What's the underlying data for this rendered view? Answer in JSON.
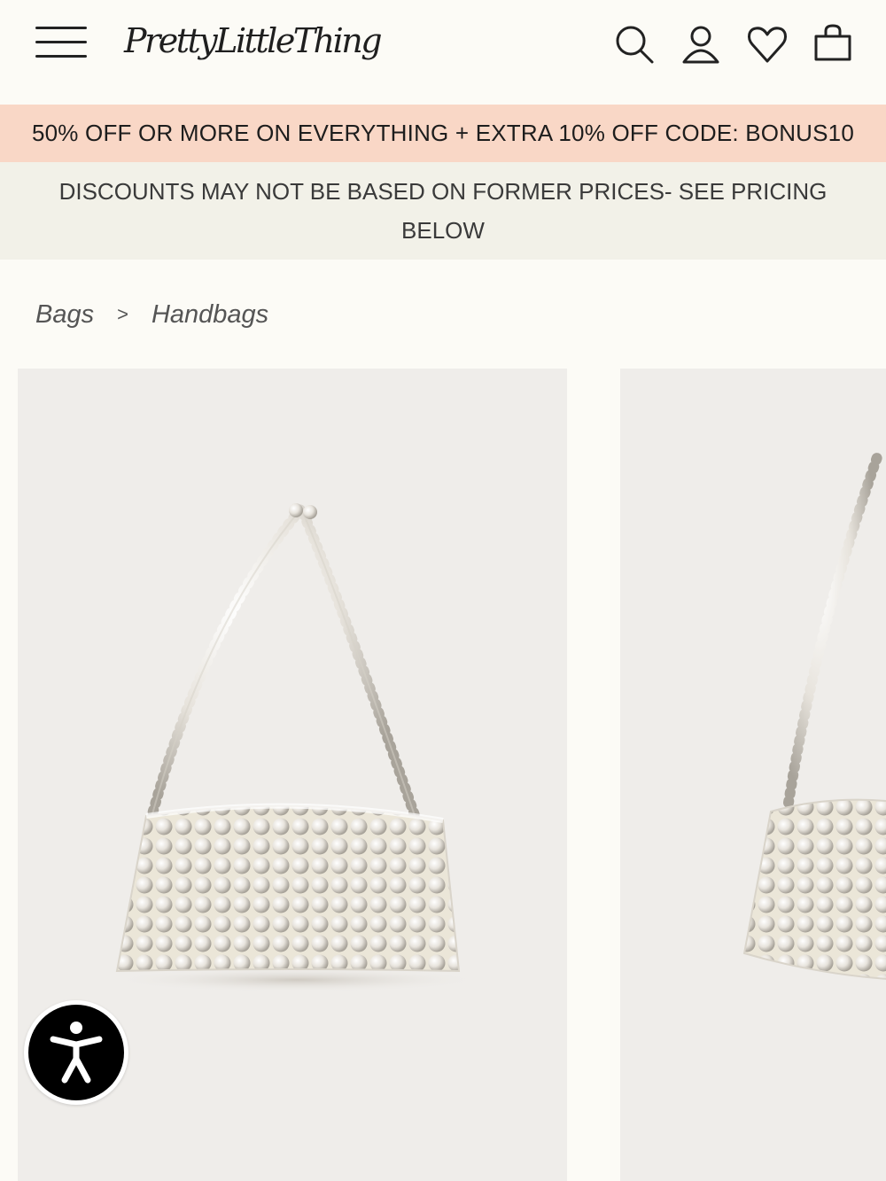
{
  "header": {
    "logo_text": "PrettyLittleThing",
    "icons": [
      "menu-icon",
      "search-icon",
      "account-icon",
      "heart-icon",
      "bag-icon"
    ]
  },
  "promo": {
    "text": "50% OFF OR MORE ON EVERYTHING + EXTRA 10% OFF CODE: BONUS10",
    "background": "#f9d7c6"
  },
  "notice": {
    "text": "DISCOUNTS MAY NOT BE BASED ON FORMER PRICES- SEE PRICING BELOW",
    "background": "#f2f1e8"
  },
  "breadcrumb": {
    "items": [
      "Bags",
      "Handbags"
    ],
    "separator": ">"
  },
  "products": [
    {
      "image": "pearl-beaded-shoulder-bag"
    },
    {
      "image": "pearl-beaded-shoulder-bag"
    }
  ],
  "accessibility": {
    "icon": "accessibility-icon"
  }
}
